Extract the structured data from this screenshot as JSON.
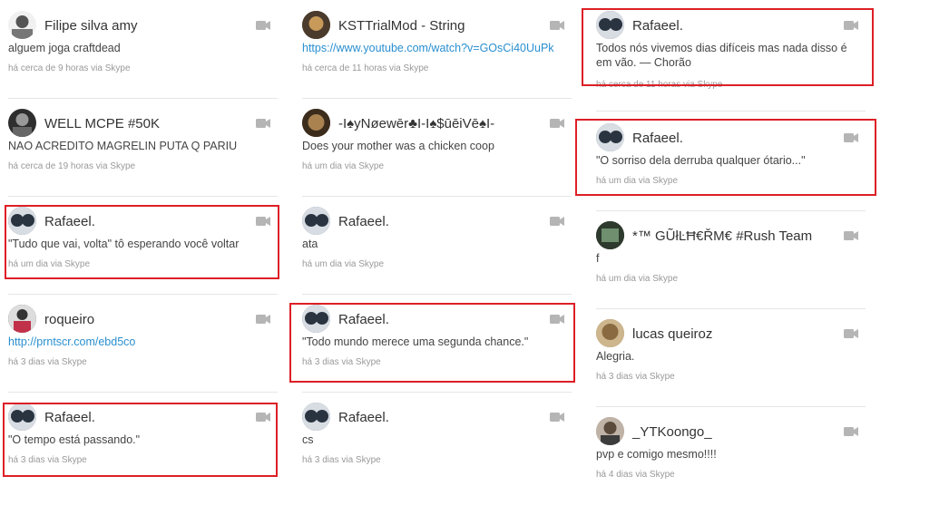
{
  "colors": {
    "highlight": "#dd1f26",
    "link": "#2a8fd0",
    "meta": "#999999"
  },
  "icons": {
    "video": "video-camera-icon"
  },
  "feed": {
    "column1": [
      {
        "name": "Filipe silva amy",
        "message": "alguem joga craftdead",
        "time": "há cerca de 9 horas via Skype"
      },
      {
        "name": "WELL MCPE #50K",
        "message": "NAO ACREDITO MAGRELIN PUTA Q PARIU",
        "time": "há cerca de 19 horas via Skype"
      },
      {
        "name": "Rafaeel.",
        "message": "\"Tudo que vai, volta\" tô esperando você voltar",
        "time": "há um dia  via Skype"
      },
      {
        "name": "roqueiro",
        "message": "http://prntscr.com/ebd5co",
        "time": "há 3 dias via Skype"
      },
      {
        "name": "Rafaeel.",
        "message": "\"O tempo está passando.\"",
        "time": "há 3 dias via Skype"
      }
    ],
    "column2": [
      {
        "name": "KSTTrialMod - String",
        "message": "https://www.youtube.com/watch?v=GOsCi40UuPk",
        "time": "há cerca de 11 horas via Skype"
      },
      {
        "name": "-I♠yNøewēr♣I-I♠$ūēiVē♠I-",
        "message": "Does your mother was a chicken coop",
        "time": "há um dia  via Skype"
      },
      {
        "name": "Rafaeel.",
        "message": "ata",
        "time": "há um dia  via Skype"
      },
      {
        "name": "Rafaeel.",
        "message": "\"Todo mundo merece uma segunda chance.\"",
        "time": "há 3 dias via Skype"
      },
      {
        "name": "Rafaeel.",
        "message": "cs",
        "time": "há 3 dias via Skype"
      }
    ],
    "column3": [
      {
        "name": "Rafaeel.",
        "message": "Todos nós vivemos dias difíceis mas nada disso é em vão. — Chorão",
        "time": "há cerca de 11 horas via Skype"
      },
      {
        "name": "Rafaeel.",
        "message": "\"O sorriso dela derruba qualquer ótario...\"",
        "time": "há um dia  via Skype"
      },
      {
        "name": "*™ GŨłĿĦ€ŘM€ #Rush Team",
        "message": "f",
        "time": "há um dia  via Skype"
      },
      {
        "name": "lucas queiroz",
        "message": "Alegria.",
        "time": "há 3 dias via Skype"
      },
      {
        "name": "_YTKoongo_",
        "message": "pvp e comigo mesmo!!!!",
        "time": "há 4 dias via Skype"
      }
    ]
  }
}
